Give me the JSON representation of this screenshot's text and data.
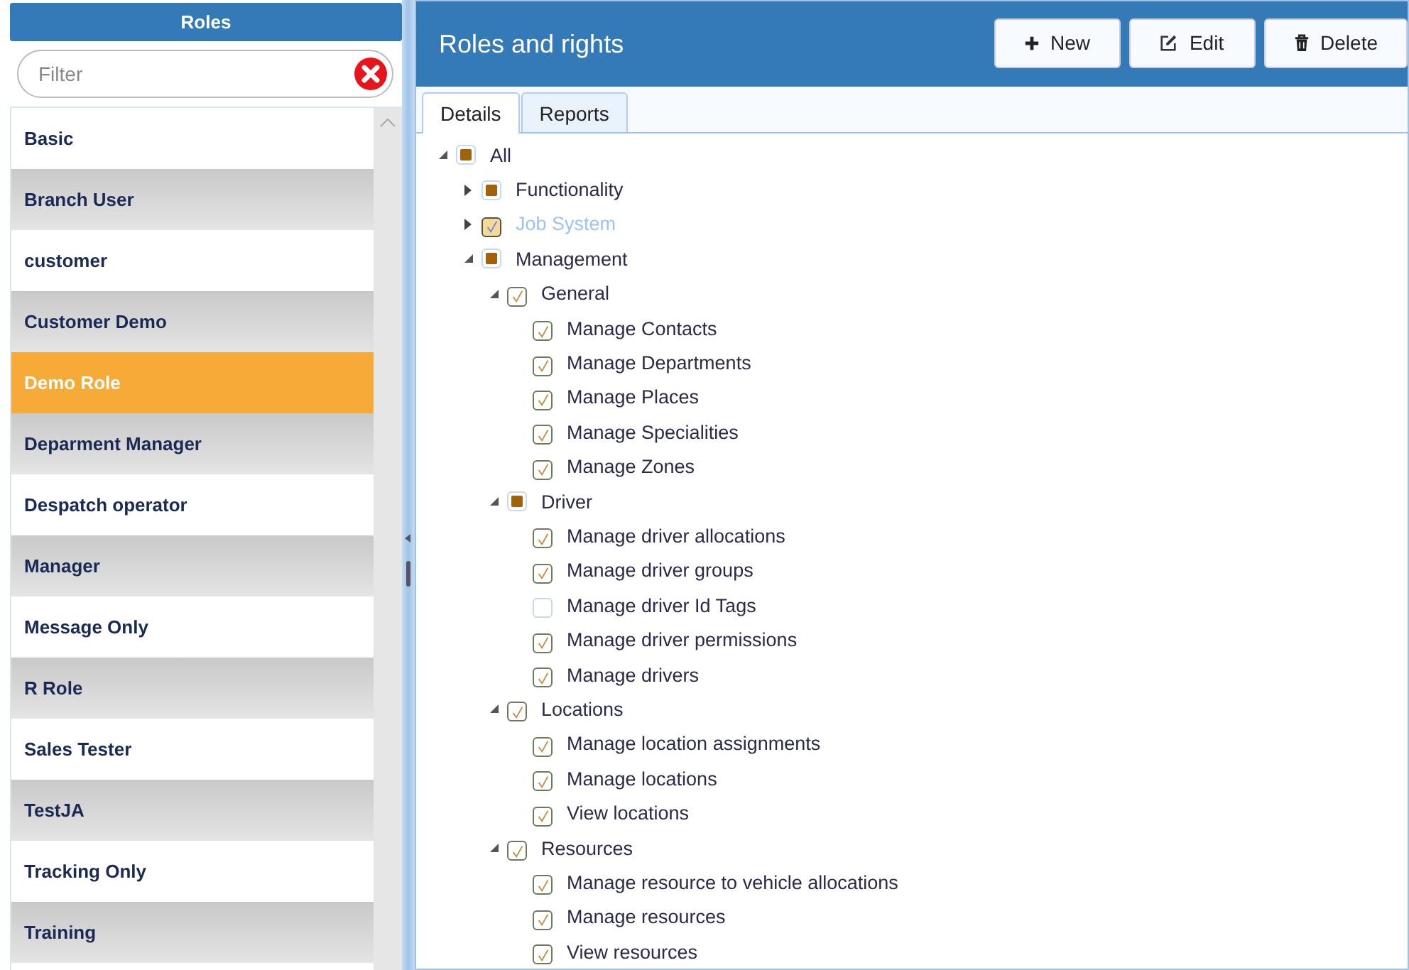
{
  "roles_panel": {
    "title": "Roles",
    "filter": {
      "placeholder": "Filter"
    },
    "roles": [
      {
        "name": "Basic",
        "selected": false
      },
      {
        "name": "Branch User",
        "selected": false
      },
      {
        "name": "customer",
        "selected": false
      },
      {
        "name": "Customer Demo",
        "selected": false
      },
      {
        "name": "Demo Role",
        "selected": true
      },
      {
        "name": "Deparment Manager",
        "selected": false
      },
      {
        "name": "Despatch operator",
        "selected": false
      },
      {
        "name": "Manager",
        "selected": false
      },
      {
        "name": "Message Only",
        "selected": false
      },
      {
        "name": "R Role",
        "selected": false
      },
      {
        "name": "Sales Tester",
        "selected": false
      },
      {
        "name": "TestJA",
        "selected": false
      },
      {
        "name": "Tracking Only",
        "selected": false
      },
      {
        "name": "Training",
        "selected": false
      }
    ]
  },
  "main": {
    "title": "Roles and rights",
    "buttons": [
      {
        "label": "New",
        "kind": "new"
      },
      {
        "label": "Edit",
        "kind": "edit"
      },
      {
        "label": "Delete",
        "kind": "delete"
      }
    ],
    "tabs": [
      {
        "label": "Details",
        "selected": true
      },
      {
        "label": "Reports",
        "selected": false
      }
    ],
    "tree": [
      {
        "label": "All",
        "checked": false,
        "partial": true,
        "disabled": false,
        "expanded": true,
        "children": [
          {
            "label": "Functionality",
            "checked": false,
            "partial": true,
            "disabled": false,
            "expanded": false
          },
          {
            "label": "Job System",
            "checked": true,
            "partial": false,
            "disabled": true,
            "expanded": false
          },
          {
            "label": "Management",
            "checked": false,
            "partial": true,
            "disabled": false,
            "expanded": true,
            "children": [
              {
                "label": "General",
                "checked": true,
                "partial": false,
                "disabled": false,
                "expanded": true,
                "children": [
                  {
                    "label": "Manage Contacts",
                    "checked": true,
                    "partial": false,
                    "disabled": false
                  },
                  {
                    "label": "Manage Departments",
                    "checked": true,
                    "partial": false,
                    "disabled": false
                  },
                  {
                    "label": "Manage Places",
                    "checked": true,
                    "partial": false,
                    "disabled": false
                  },
                  {
                    "label": "Manage Specialities",
                    "checked": true,
                    "partial": false,
                    "disabled": false
                  },
                  {
                    "label": "Manage Zones",
                    "checked": true,
                    "partial": false,
                    "disabled": false
                  }
                ]
              },
              {
                "label": "Driver",
                "checked": false,
                "partial": true,
                "disabled": false,
                "expanded": true,
                "children": [
                  {
                    "label": "Manage driver allocations",
                    "checked": true,
                    "partial": false,
                    "disabled": false
                  },
                  {
                    "label": "Manage driver groups",
                    "checked": true,
                    "partial": false,
                    "disabled": false
                  },
                  {
                    "label": "Manage driver Id Tags",
                    "checked": false,
                    "partial": false,
                    "disabled": false
                  },
                  {
                    "label": "Manage driver permissions",
                    "checked": true,
                    "partial": false,
                    "disabled": false
                  },
                  {
                    "label": "Manage drivers",
                    "checked": true,
                    "partial": false,
                    "disabled": false
                  }
                ]
              },
              {
                "label": "Locations",
                "checked": true,
                "partial": false,
                "disabled": false,
                "expanded": true,
                "children": [
                  {
                    "label": "Manage location assignments",
                    "checked": true,
                    "partial": false,
                    "disabled": false
                  },
                  {
                    "label": "Manage locations",
                    "checked": true,
                    "partial": false,
                    "disabled": false
                  },
                  {
                    "label": "View locations",
                    "checked": true,
                    "partial": false,
                    "disabled": false
                  }
                ]
              },
              {
                "label": "Resources",
                "checked": true,
                "partial": false,
                "disabled": false,
                "expanded": true,
                "children": [
                  {
                    "label": "Manage resource to vehicle allocations",
                    "checked": true,
                    "partial": false,
                    "disabled": false
                  },
                  {
                    "label": "Manage resources",
                    "checked": true,
                    "partial": false,
                    "disabled": false
                  },
                  {
                    "label": "View resources",
                    "checked": true,
                    "partial": false,
                    "disabled": false
                  }
                ]
              }
            ]
          }
        ]
      }
    ]
  }
}
